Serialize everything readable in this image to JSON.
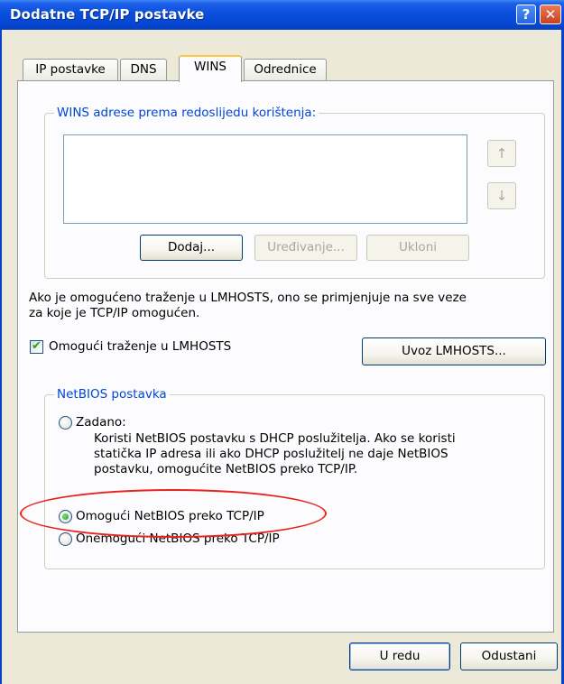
{
  "window": {
    "title": "Dodatne TCP/IP postavke",
    "help_button": "?",
    "close_button": "✕"
  },
  "tabs": [
    {
      "label": "IP postavke",
      "active": false
    },
    {
      "label": "DNS",
      "active": false
    },
    {
      "label": "WINS",
      "active": true
    },
    {
      "label": "Odrednice",
      "active": false
    }
  ],
  "wins": {
    "group_label": "WINS adrese prema redoslijedu korištenja:",
    "up_arrow": "↑",
    "down_arrow": "↓",
    "add_label": "Dodaj...",
    "edit_label": "Uređivanje...",
    "remove_label": "Ukloni"
  },
  "lmhosts": {
    "description_line1": "Ako je omogućeno traženje u LMHOSTS, ono se primjenjuje na sve veze",
    "description_line2": "za koje je TCP/IP omogućen.",
    "checkbox_label": "Omogući traženje u LMHOSTS",
    "checkbox_checked": true,
    "import_label": "Uvoz LMHOSTS..."
  },
  "netbios": {
    "group_label": "NetBIOS postavka",
    "default_label": "Zadano:",
    "default_desc_line1": "Koristi NetBIOS postavku s DHCP poslužitelja. Ako se koristi",
    "default_desc_line2": "statička IP adresa ili ako DHCP poslužitelj ne daje NetBIOS",
    "default_desc_line3": "postavku, omogućite NetBIOS preko TCP/IP.",
    "enable_label": "Omogući NetBIOS preko TCP/IP",
    "disable_label": "Onemogući NetBIOS preko TCP/IP",
    "selected": "enable"
  },
  "footer": {
    "ok_label": "U redu",
    "cancel_label": "Odustani"
  },
  "colors": {
    "title_blue": "#0a4fdc",
    "group_label_blue": "#0046d5",
    "annotation_red": "#e8231b"
  }
}
